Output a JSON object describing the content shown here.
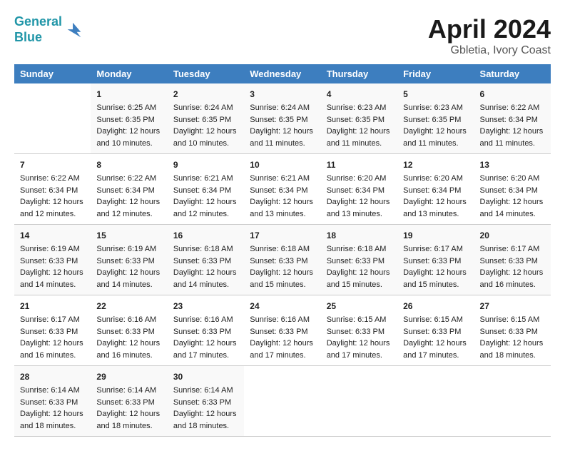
{
  "header": {
    "logo_line1": "General",
    "logo_line2": "Blue",
    "title": "April 2024",
    "subtitle": "Gbletia, Ivory Coast"
  },
  "columns": [
    "Sunday",
    "Monday",
    "Tuesday",
    "Wednesday",
    "Thursday",
    "Friday",
    "Saturday"
  ],
  "weeks": [
    [
      {
        "day": "",
        "sunrise": "",
        "sunset": "",
        "daylight": ""
      },
      {
        "day": "1",
        "sunrise": "Sunrise: 6:25 AM",
        "sunset": "Sunset: 6:35 PM",
        "daylight": "Daylight: 12 hours and 10 minutes."
      },
      {
        "day": "2",
        "sunrise": "Sunrise: 6:24 AM",
        "sunset": "Sunset: 6:35 PM",
        "daylight": "Daylight: 12 hours and 10 minutes."
      },
      {
        "day": "3",
        "sunrise": "Sunrise: 6:24 AM",
        "sunset": "Sunset: 6:35 PM",
        "daylight": "Daylight: 12 hours and 11 minutes."
      },
      {
        "day": "4",
        "sunrise": "Sunrise: 6:23 AM",
        "sunset": "Sunset: 6:35 PM",
        "daylight": "Daylight: 12 hours and 11 minutes."
      },
      {
        "day": "5",
        "sunrise": "Sunrise: 6:23 AM",
        "sunset": "Sunset: 6:35 PM",
        "daylight": "Daylight: 12 hours and 11 minutes."
      },
      {
        "day": "6",
        "sunrise": "Sunrise: 6:22 AM",
        "sunset": "Sunset: 6:34 PM",
        "daylight": "Daylight: 12 hours and 11 minutes."
      }
    ],
    [
      {
        "day": "7",
        "sunrise": "Sunrise: 6:22 AM",
        "sunset": "Sunset: 6:34 PM",
        "daylight": "Daylight: 12 hours and 12 minutes."
      },
      {
        "day": "8",
        "sunrise": "Sunrise: 6:22 AM",
        "sunset": "Sunset: 6:34 PM",
        "daylight": "Daylight: 12 hours and 12 minutes."
      },
      {
        "day": "9",
        "sunrise": "Sunrise: 6:21 AM",
        "sunset": "Sunset: 6:34 PM",
        "daylight": "Daylight: 12 hours and 12 minutes."
      },
      {
        "day": "10",
        "sunrise": "Sunrise: 6:21 AM",
        "sunset": "Sunset: 6:34 PM",
        "daylight": "Daylight: 12 hours and 13 minutes."
      },
      {
        "day": "11",
        "sunrise": "Sunrise: 6:20 AM",
        "sunset": "Sunset: 6:34 PM",
        "daylight": "Daylight: 12 hours and 13 minutes."
      },
      {
        "day": "12",
        "sunrise": "Sunrise: 6:20 AM",
        "sunset": "Sunset: 6:34 PM",
        "daylight": "Daylight: 12 hours and 13 minutes."
      },
      {
        "day": "13",
        "sunrise": "Sunrise: 6:20 AM",
        "sunset": "Sunset: 6:34 PM",
        "daylight": "Daylight: 12 hours and 14 minutes."
      }
    ],
    [
      {
        "day": "14",
        "sunrise": "Sunrise: 6:19 AM",
        "sunset": "Sunset: 6:33 PM",
        "daylight": "Daylight: 12 hours and 14 minutes."
      },
      {
        "day": "15",
        "sunrise": "Sunrise: 6:19 AM",
        "sunset": "Sunset: 6:33 PM",
        "daylight": "Daylight: 12 hours and 14 minutes."
      },
      {
        "day": "16",
        "sunrise": "Sunrise: 6:18 AM",
        "sunset": "Sunset: 6:33 PM",
        "daylight": "Daylight: 12 hours and 14 minutes."
      },
      {
        "day": "17",
        "sunrise": "Sunrise: 6:18 AM",
        "sunset": "Sunset: 6:33 PM",
        "daylight": "Daylight: 12 hours and 15 minutes."
      },
      {
        "day": "18",
        "sunrise": "Sunrise: 6:18 AM",
        "sunset": "Sunset: 6:33 PM",
        "daylight": "Daylight: 12 hours and 15 minutes."
      },
      {
        "day": "19",
        "sunrise": "Sunrise: 6:17 AM",
        "sunset": "Sunset: 6:33 PM",
        "daylight": "Daylight: 12 hours and 15 minutes."
      },
      {
        "day": "20",
        "sunrise": "Sunrise: 6:17 AM",
        "sunset": "Sunset: 6:33 PM",
        "daylight": "Daylight: 12 hours and 16 minutes."
      }
    ],
    [
      {
        "day": "21",
        "sunrise": "Sunrise: 6:17 AM",
        "sunset": "Sunset: 6:33 PM",
        "daylight": "Daylight: 12 hours and 16 minutes."
      },
      {
        "day": "22",
        "sunrise": "Sunrise: 6:16 AM",
        "sunset": "Sunset: 6:33 PM",
        "daylight": "Daylight: 12 hours and 16 minutes."
      },
      {
        "day": "23",
        "sunrise": "Sunrise: 6:16 AM",
        "sunset": "Sunset: 6:33 PM",
        "daylight": "Daylight: 12 hours and 17 minutes."
      },
      {
        "day": "24",
        "sunrise": "Sunrise: 6:16 AM",
        "sunset": "Sunset: 6:33 PM",
        "daylight": "Daylight: 12 hours and 17 minutes."
      },
      {
        "day": "25",
        "sunrise": "Sunrise: 6:15 AM",
        "sunset": "Sunset: 6:33 PM",
        "daylight": "Daylight: 12 hours and 17 minutes."
      },
      {
        "day": "26",
        "sunrise": "Sunrise: 6:15 AM",
        "sunset": "Sunset: 6:33 PM",
        "daylight": "Daylight: 12 hours and 17 minutes."
      },
      {
        "day": "27",
        "sunrise": "Sunrise: 6:15 AM",
        "sunset": "Sunset: 6:33 PM",
        "daylight": "Daylight: 12 hours and 18 minutes."
      }
    ],
    [
      {
        "day": "28",
        "sunrise": "Sunrise: 6:14 AM",
        "sunset": "Sunset: 6:33 PM",
        "daylight": "Daylight: 12 hours and 18 minutes."
      },
      {
        "day": "29",
        "sunrise": "Sunrise: 6:14 AM",
        "sunset": "Sunset: 6:33 PM",
        "daylight": "Daylight: 12 hours and 18 minutes."
      },
      {
        "day": "30",
        "sunrise": "Sunrise: 6:14 AM",
        "sunset": "Sunset: 6:33 PM",
        "daylight": "Daylight: 12 hours and 18 minutes."
      },
      {
        "day": "",
        "sunrise": "",
        "sunset": "",
        "daylight": ""
      },
      {
        "day": "",
        "sunrise": "",
        "sunset": "",
        "daylight": ""
      },
      {
        "day": "",
        "sunrise": "",
        "sunset": "",
        "daylight": ""
      },
      {
        "day": "",
        "sunrise": "",
        "sunset": "",
        "daylight": ""
      }
    ]
  ]
}
